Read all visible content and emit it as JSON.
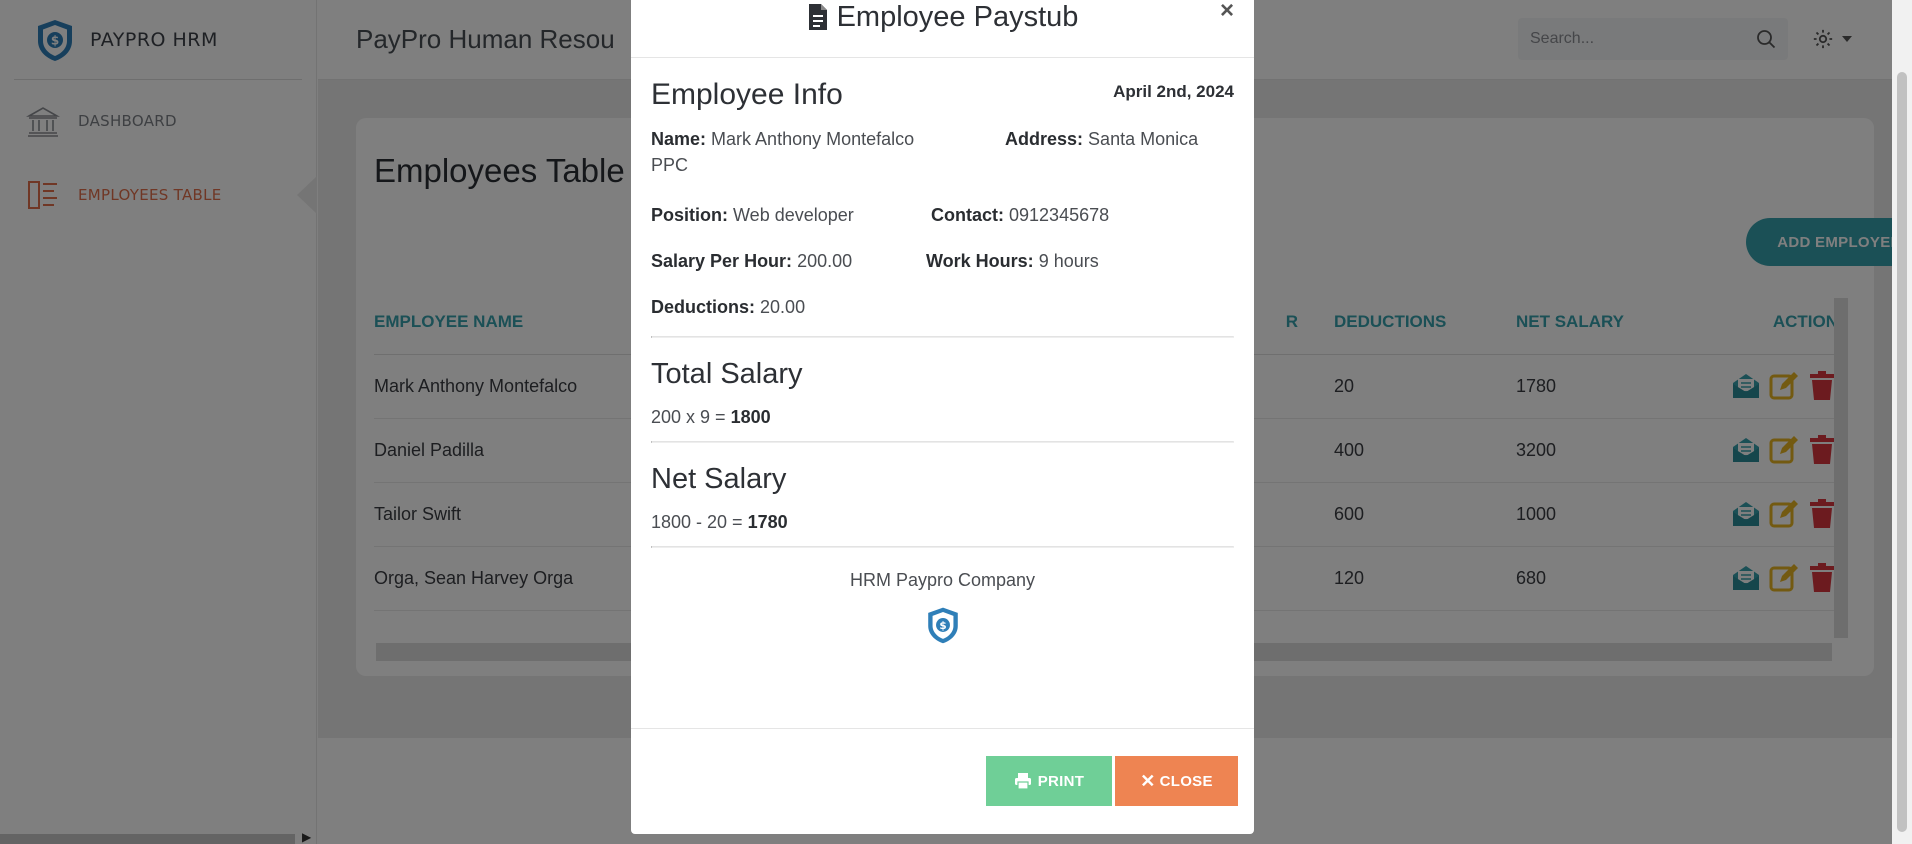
{
  "sidebar": {
    "brand": "PAYPRO HRM",
    "items": [
      {
        "label": "DASHBOARD",
        "icon": "bank-icon",
        "active": false
      },
      {
        "label": "EMPLOYEES TABLE",
        "icon": "table-list-icon",
        "active": true
      }
    ]
  },
  "header": {
    "app_title": "PayPro Human Resou",
    "search_placeholder": "Search..."
  },
  "card": {
    "title": "Employees Table",
    "add_button": "ADD EMPLOYEE",
    "columns": {
      "name": "EMPLOYEE NAME",
      "hidden_partial": "R",
      "deductions": "DEDUCTIONS",
      "net_salary": "NET SALARY",
      "action": "ACTION"
    },
    "rows": [
      {
        "name": "Mark Anthony Montefalco",
        "deductions": "20",
        "net": "1780"
      },
      {
        "name": "Daniel Padilla",
        "deductions": "400",
        "net": "3200"
      },
      {
        "name": "Tailor Swift",
        "deductions": "600",
        "net": "1000"
      },
      {
        "name": "Orga, Sean Harvey Orga",
        "deductions": "120",
        "net": "680"
      }
    ]
  },
  "modal": {
    "title": "Employee Paystub",
    "close_symbol": "×",
    "info_title": "Employee Info",
    "date": "April 2nd, 2024",
    "fields": {
      "name_label": "Name:",
      "name_value": "Mark Anthony Montefalco PPC",
      "address_label": "Address:",
      "address_value": "Santa Monica",
      "position_label": "Position:",
      "position_value": "Web developer",
      "contact_label": "Contact:",
      "contact_value": "0912345678",
      "salary_label": "Salary Per Hour:",
      "salary_value": "200.00",
      "hours_label": "Work Hours:",
      "hours_value": "9 hours",
      "deductions_label": "Deductions:",
      "deductions_value": "20.00"
    },
    "total_title": "Total Salary",
    "total_expr": "200 x 9 = ",
    "total_value": "1800",
    "net_title": "Net Salary",
    "net_expr": "1800 - 20 = ",
    "net_value": "1780",
    "company": "HRM Paypro Company",
    "print_label": "PRINT",
    "close_label": "CLOSE"
  },
  "colors": {
    "teal": "#37a0ad",
    "orange": "#ee8452",
    "green": "#6fcf97",
    "red": "#d9363e",
    "yellow": "#e6b422"
  }
}
